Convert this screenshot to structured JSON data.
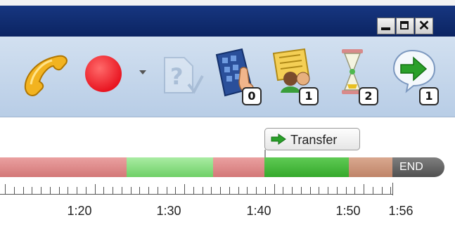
{
  "window": {
    "controls": {
      "minimize_icon": "minimize-icon",
      "maximize_icon": "maximize-icon",
      "close_symbol": "✕"
    }
  },
  "toolbar": {
    "items": [
      {
        "name": "phone",
        "icon": "phone-handset-icon"
      },
      {
        "name": "record",
        "icon": "record-icon",
        "color": "#e8131f"
      },
      {
        "name": "record-dropdown",
        "icon": "chevron-down-icon"
      },
      {
        "name": "help-document",
        "icon": "document-question-icon"
      },
      {
        "name": "keypad",
        "icon": "keypad-hand-icon",
        "badge": "0"
      },
      {
        "name": "contacts",
        "icon": "contact-card-icon",
        "badge": "1"
      },
      {
        "name": "hold",
        "icon": "hourglass-icon",
        "badge": "2"
      },
      {
        "name": "transfer",
        "icon": "transfer-arrow-icon",
        "badge": "1"
      }
    ]
  },
  "timeline": {
    "event": {
      "label": "Transfer",
      "icon": "green-arrow-icon"
    },
    "end_label": "END",
    "tick_labels": [
      "1:20",
      "1:30",
      "1:40",
      "1:50",
      "1:56"
    ],
    "segments": [
      {
        "type": "talk",
        "color": "#d37878"
      },
      {
        "type": "hold",
        "color": "#6fd067"
      },
      {
        "type": "talk",
        "color": "#d37878"
      },
      {
        "type": "transfer",
        "color": "#35a92c"
      },
      {
        "type": "wrap-up",
        "color": "#bf8468"
      }
    ]
  }
}
